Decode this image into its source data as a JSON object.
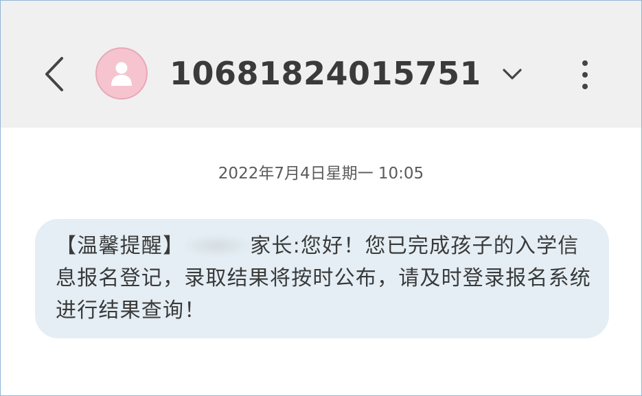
{
  "header": {
    "contact_name": "10681824015751...",
    "back_icon": "chevron-left-icon",
    "avatar_icon": "person-icon",
    "expand_icon": "chevron-down-icon",
    "more_icon": "more-vertical-icon",
    "avatar_color": "#f5c4cf"
  },
  "conversation": {
    "timestamp": "2022年7月4日星期一 10:05",
    "messages": [
      {
        "prefix": "【温馨提醒】",
        "body": "家长:您好！您已完成孩子的入学信息报名登记，录取结果将按时公布，请及时登录报名系统进行结果查询！",
        "bubble_color": "#e4eef4"
      }
    ]
  }
}
